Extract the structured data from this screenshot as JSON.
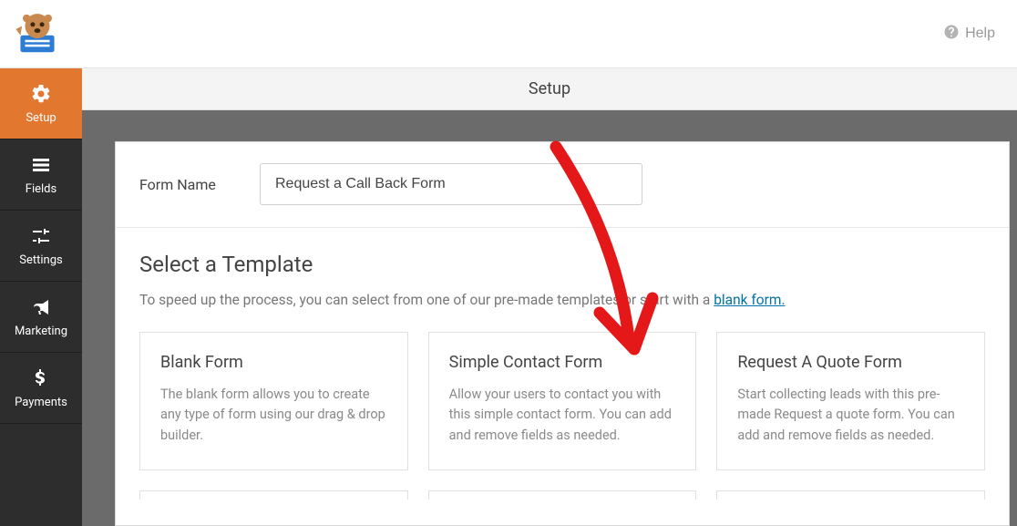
{
  "topbar": {
    "help_label": "Help"
  },
  "sidebar": {
    "items": [
      {
        "label": "Setup",
        "icon": "gear-icon",
        "active": true
      },
      {
        "label": "Fields",
        "icon": "list-icon",
        "active": false
      },
      {
        "label": "Settings",
        "icon": "sliders-icon",
        "active": false
      },
      {
        "label": "Marketing",
        "icon": "megaphone-icon",
        "active": false
      },
      {
        "label": "Payments",
        "icon": "dollar-icon",
        "active": false
      }
    ]
  },
  "page": {
    "title": "Setup",
    "form_name_label": "Form Name",
    "form_name_value": "Request a Call Back Form",
    "template_heading": "Select a Template",
    "template_sub_before": "To speed up the process, you can select from one of our pre-",
    "template_sub_after": " templates or start with a ",
    "template_sub_link": "blank form.",
    "templates": [
      {
        "title": "Blank Form",
        "desc": "The blank form allows you to create any type of form using our drag & drop builder."
      },
      {
        "title": "Simple Contact Form",
        "desc": "Allow your users to contact you with this simple contact form. You can add and remove fields as needed."
      },
      {
        "title": "Request A Quote Form",
        "desc": "Start collecting leads with this pre-made Request a quote form. You can add and remove fields as needed."
      }
    ]
  }
}
